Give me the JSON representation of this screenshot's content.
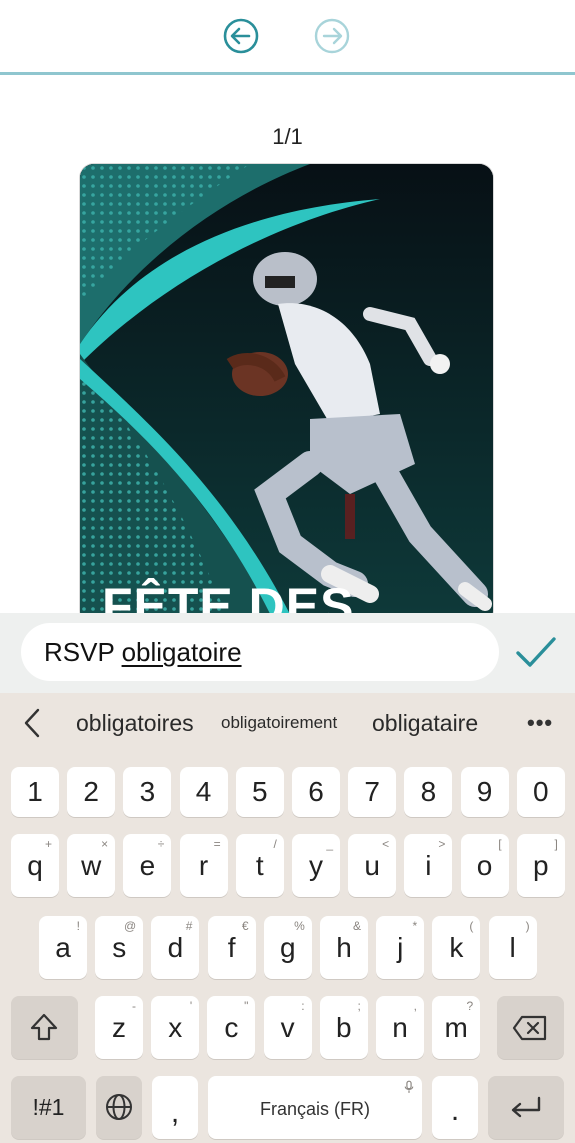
{
  "toolbar": {
    "undo_icon": "undo-arrow-icon",
    "redo_icon": "redo-arrow-icon",
    "accent": "#2a8f9a"
  },
  "page_counter": "1/1",
  "card": {
    "title_fragment": "FÊTE DES",
    "accent": "#2ec4c0"
  },
  "entry": {
    "prefix": "RSVP ",
    "current_word": "obligatoire",
    "confirm_icon": "checkmark-icon"
  },
  "keyboard": {
    "suggestions": [
      "obligatoires",
      "obligatoirement",
      "obligataire"
    ],
    "more_label": "•••",
    "numbers": [
      "1",
      "2",
      "3",
      "4",
      "5",
      "6",
      "7",
      "8",
      "9",
      "0"
    ],
    "row_q": [
      {
        "k": "q",
        "s": "+"
      },
      {
        "k": "w",
        "s": "×"
      },
      {
        "k": "e",
        "s": "÷"
      },
      {
        "k": "r",
        "s": "="
      },
      {
        "k": "t",
        "s": "/"
      },
      {
        "k": "y",
        "s": "_"
      },
      {
        "k": "u",
        "s": "<"
      },
      {
        "k": "i",
        "s": ">"
      },
      {
        "k": "o",
        "s": "["
      },
      {
        "k": "p",
        "s": "]"
      }
    ],
    "row_a": [
      {
        "k": "a",
        "s": "!"
      },
      {
        "k": "s",
        "s": "@"
      },
      {
        "k": "d",
        "s": "#"
      },
      {
        "k": "f",
        "s": "€"
      },
      {
        "k": "g",
        "s": "%"
      },
      {
        "k": "h",
        "s": "&"
      },
      {
        "k": "j",
        "s": "*"
      },
      {
        "k": "k",
        "s": "("
      },
      {
        "k": "l",
        "s": ")"
      }
    ],
    "row_z": [
      {
        "k": "z",
        "s": "-"
      },
      {
        "k": "x",
        "s": "'"
      },
      {
        "k": "c",
        "s": "\""
      },
      {
        "k": "v",
        "s": ":"
      },
      {
        "k": "b",
        "s": ";"
      },
      {
        "k": "n",
        "s": ","
      },
      {
        "k": "m",
        "s": "?"
      }
    ],
    "symbols_label": "!#1",
    "comma_label": ",",
    "space_label": "Français (FR)",
    "period_label": "."
  }
}
